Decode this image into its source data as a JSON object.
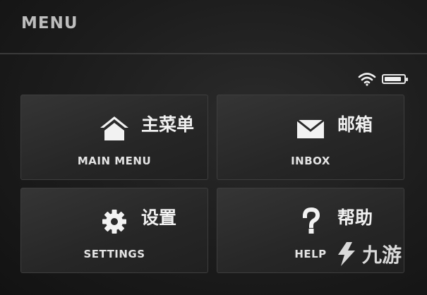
{
  "header": {
    "title": "MENU"
  },
  "status": {
    "wifi_icon": "wifi-icon",
    "battery_icon": "battery-icon",
    "battery_level": 0.9
  },
  "tiles": [
    {
      "cn": "主菜单",
      "en": "MAIN MENU",
      "icon": "home-icon"
    },
    {
      "cn": "邮箱",
      "en": "INBOX",
      "icon": "mail-icon"
    },
    {
      "cn": "设置",
      "en": "SETTINGS",
      "icon": "gear-icon"
    },
    {
      "cn": "帮助",
      "en": "HELP",
      "icon": "question-icon"
    }
  ],
  "watermark": {
    "text": "九游",
    "logo": "jiuyou-logo"
  }
}
